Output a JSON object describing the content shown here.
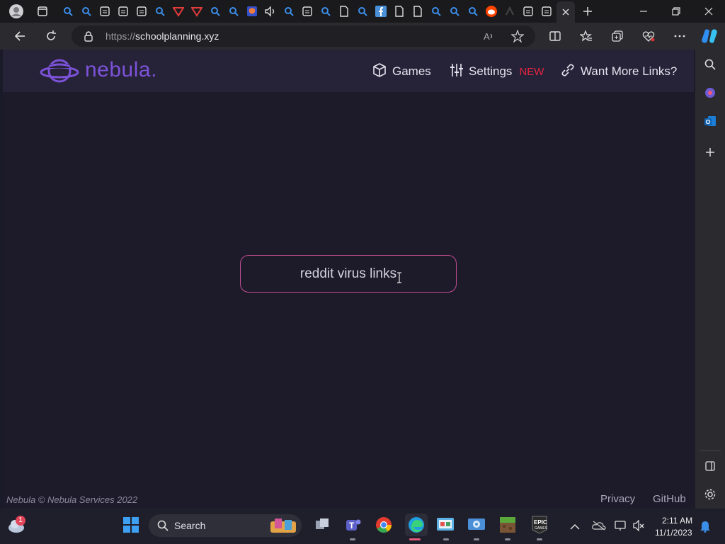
{
  "browser": {
    "url_prefix": "https://",
    "url_host": "schoolplanning.xyz"
  },
  "site": {
    "logo_text": "nebula.",
    "nav": {
      "games_label": "Games",
      "settings_label": "Settings",
      "settings_badge": "NEW",
      "links_label": "Want More Links?"
    },
    "search_value": "reddit virus links",
    "footer_copyright": "Nebula © Nebula Services 2022",
    "footer_privacy": "Privacy",
    "footer_github": "GitHub"
  },
  "taskbar": {
    "search_label": "Search",
    "weather_badge": "1",
    "clock_time": "2:11 AM",
    "clock_date": "11/1/2023"
  },
  "colors": {
    "accent_purple": "#7c52d8",
    "badge_red": "#e3253f",
    "search_border": "#c24d93",
    "page_bg": "#1d1b2a"
  }
}
